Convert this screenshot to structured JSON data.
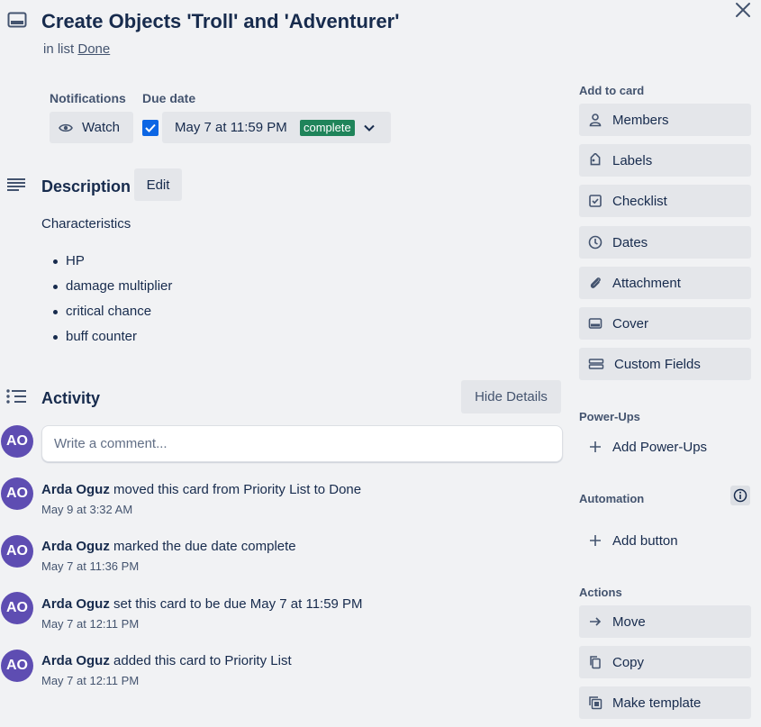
{
  "card": {
    "title": "Create Objects 'Troll' and 'Adventurer'",
    "in_list_prefix": "in list",
    "list_name": "Done"
  },
  "notifications": {
    "label": "Notifications",
    "watch_label": "Watch"
  },
  "due_date": {
    "label": "Due date",
    "value": "May 7 at 11:59 PM",
    "status": "complete",
    "checked": true
  },
  "description": {
    "title": "Description",
    "edit_label": "Edit",
    "paragraph": "Characteristics",
    "bullets": [
      "HP",
      "damage multiplier",
      "critical chance",
      "buff counter"
    ]
  },
  "activity": {
    "title": "Activity",
    "hide_details_label": "Hide Details",
    "comment_placeholder": "Write a comment...",
    "user_initials": "AO",
    "items": [
      {
        "initials": "AO",
        "user": "Arda Oguz",
        "action": "moved this card from Priority List to Done",
        "time": "May 9 at 3:32 AM"
      },
      {
        "initials": "AO",
        "user": "Arda Oguz",
        "action": "marked the due date complete",
        "time": "May 7 at 11:36 PM"
      },
      {
        "initials": "AO",
        "user": "Arda Oguz",
        "action": "set this card to be due May 7 at 11:59 PM",
        "time": "May 7 at 12:11 PM"
      },
      {
        "initials": "AO",
        "user": "Arda Oguz",
        "action": "added this card to Priority List",
        "time": "May 7 at 12:11 PM"
      }
    ]
  },
  "sidebar": {
    "add_to_card_label": "Add to card",
    "add_to_card": [
      {
        "label": "Members",
        "icon": "person-icon"
      },
      {
        "label": "Labels",
        "icon": "tag-icon"
      },
      {
        "label": "Checklist",
        "icon": "checklist-icon"
      },
      {
        "label": "Dates",
        "icon": "clock-icon"
      },
      {
        "label": "Attachment",
        "icon": "paperclip-icon"
      },
      {
        "label": "Cover",
        "icon": "cover-icon"
      },
      {
        "label": "Custom Fields",
        "icon": "custom-fields-icon"
      }
    ],
    "power_ups_label": "Power-Ups",
    "add_power_ups_label": "Add Power-Ups",
    "automation_label": "Automation",
    "add_button_label": "Add button",
    "actions_label": "Actions",
    "actions": [
      {
        "label": "Move",
        "icon": "arrow-right-icon"
      },
      {
        "label": "Copy",
        "icon": "copy-icon"
      },
      {
        "label": "Make template",
        "icon": "template-icon"
      }
    ]
  },
  "colors": {
    "background": "#f1f2f4",
    "button": "#e4e6ea",
    "accent": "#0c66e4",
    "complete_badge": "#1f845a",
    "avatar": "#5e4db2",
    "text": "#172b4d"
  }
}
